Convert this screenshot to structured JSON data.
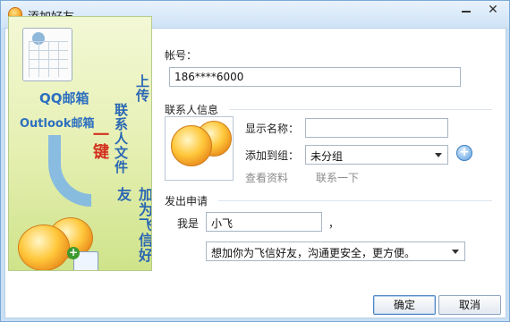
{
  "window": {
    "title": "添加好友",
    "minimize_label": "—",
    "close_label": "✕"
  },
  "banner": {
    "mail_brand": "QQ邮箱",
    "outlook_brand": "Outlook邮箱",
    "col1": "上传",
    "col2": "联系人文件",
    "col3": "一键",
    "col4": "加为飞信好友"
  },
  "account": {
    "label": "帐号：",
    "value": "186****6000"
  },
  "contact_info": {
    "section_label": "联系人信息",
    "display_name_label": "显示名称：",
    "display_name_value": "",
    "group_label": "添加到组：",
    "group_value": "未分组",
    "view_profile_link": "查看资料",
    "contact_link": "联系一下",
    "add_group_label": "+"
  },
  "request": {
    "section_label": "发出申请",
    "i_am_label": "我是",
    "name_value": "小飞",
    "comma": "，",
    "message_value": "想加你为飞信好友，沟通更安全，更方便。"
  },
  "buttons": {
    "ok": "确定",
    "cancel": "取消"
  },
  "colors": {
    "accent": "#2d6fc0",
    "highlight_red": "#d3301f",
    "banner_bg": "#e6f0b4"
  }
}
